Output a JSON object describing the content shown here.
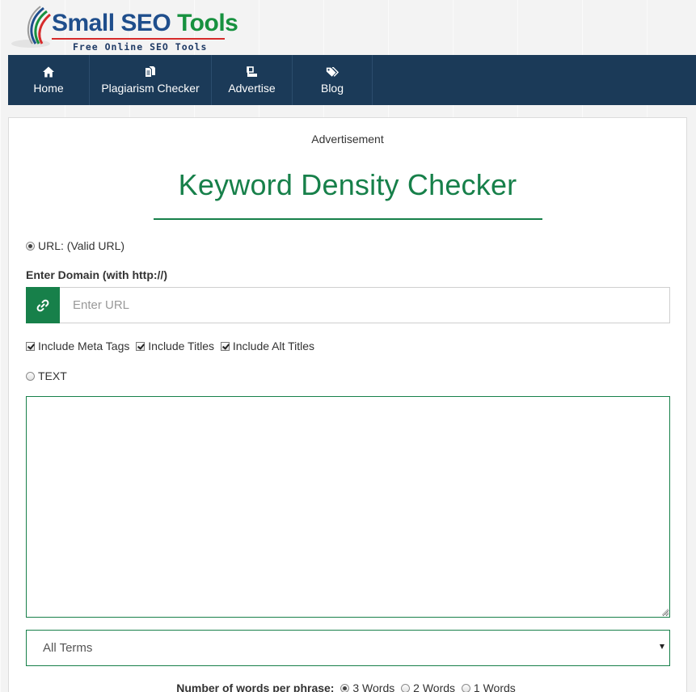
{
  "brand": {
    "name_part1": "Small SEO",
    "name_part2": "Tools",
    "tagline": "Free Online SEO Tools"
  },
  "nav": {
    "items": [
      {
        "label": "Home",
        "icon": "home-icon"
      },
      {
        "label": "Plagiarism Checker",
        "icon": "copy-documents-icon"
      },
      {
        "label": "Advertise",
        "icon": "billboard-icon"
      },
      {
        "label": "Blog",
        "icon": "tags-icon"
      }
    ]
  },
  "main": {
    "ad_label": "Advertisement",
    "title": "Keyword Density Checker",
    "url_option_label": "URL: (Valid URL)",
    "url_option_selected": true,
    "domain_label": "Enter Domain (with http://)",
    "url_input": {
      "value": "",
      "placeholder": "Enter URL",
      "icon": "link-icon"
    },
    "checkboxes": [
      {
        "label": "Include Meta Tags",
        "checked": true
      },
      {
        "label": "Include Titles",
        "checked": true
      },
      {
        "label": "Include Alt Titles",
        "checked": true
      }
    ],
    "text_option_label": "TEXT",
    "text_option_selected": false,
    "text_area_value": "",
    "terms_select": {
      "selected": "All Terms"
    },
    "words_per_phrase": {
      "label": "Number of words per phrase:",
      "options": [
        {
          "label": "3 Words",
          "selected": true
        },
        {
          "label": "2 Words",
          "selected": false
        },
        {
          "label": "1 Words",
          "selected": false
        }
      ]
    }
  },
  "colors": {
    "nav_background": "#1b3a58",
    "accent_green": "#17804a",
    "logo_blue": "#1f4e8c",
    "logo_green": "#17913f",
    "logo_red": "#d62b2b"
  }
}
